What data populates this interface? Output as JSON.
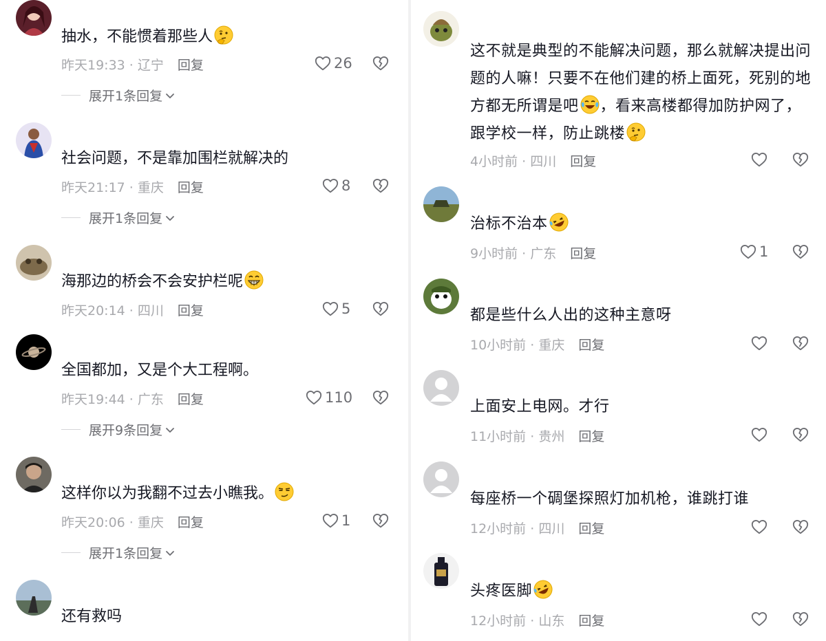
{
  "left_comments": [
    {
      "text": "抽水，不能惯着那些人",
      "emoji": "thinking-emoji",
      "time": "昨天19:33",
      "location": "辽宁",
      "reply_label": "回复",
      "likes": "26",
      "expand_label": "展开1条回复"
    },
    {
      "text": "社会问题，不是靠加围栏就解决的",
      "time": "昨天21:17",
      "location": "重庆",
      "reply_label": "回复",
      "likes": "8",
      "expand_label": "展开1条回复"
    },
    {
      "text": "海那边的桥会不会安护栏呢",
      "emoji": "grin-emoji",
      "time": "昨天20:14",
      "location": "四川",
      "reply_label": "回复",
      "likes": "5"
    },
    {
      "text": "全国都加，又是个大工程啊。",
      "time": "昨天19:44",
      "location": "广东",
      "reply_label": "回复",
      "likes": "110",
      "expand_label": "展开9条回复"
    },
    {
      "text": "这样你以为我翻不过去小瞧我。",
      "emoji": "smirk-emoji",
      "time": "昨天20:06",
      "location": "重庆",
      "reply_label": "回复",
      "likes": "1",
      "expand_label": "展开1条回复"
    },
    {
      "text": "还有救吗"
    }
  ],
  "right_comments": [
    {
      "text_parts": [
        "这不就是典型的不能解决问题，那么就解决提出问题的人嘛！只要不在他们建的桥上面死，死别的地方都无所谓是吧",
        "，看来高楼都得加防护网了，跟学校一样，防止跳楼"
      ],
      "emoji": "laugh-cry-emoji",
      "emoji2": "thinking-emoji",
      "time": "4小时前",
      "location": "四川",
      "reply_label": "回复",
      "likes": ""
    },
    {
      "text": "治标不治本",
      "emoji": "rofl-emoji",
      "time": "9小时前",
      "location": "广东",
      "reply_label": "回复",
      "likes": "1"
    },
    {
      "text": "都是些什么人出的这种主意呀",
      "time": "10小时前",
      "location": "重庆",
      "reply_label": "回复",
      "likes": ""
    },
    {
      "text": "上面安上电网。才行",
      "time": "11小时前",
      "location": "贵州",
      "reply_label": "回复",
      "likes": ""
    },
    {
      "text": "每座桥一个碉堡探照灯加机枪，谁跳打谁",
      "time": "12小时前",
      "location": "四川",
      "reply_label": "回复",
      "likes": ""
    },
    {
      "text": "头疼医脚",
      "emoji": "rofl-emoji",
      "time": "12小时前",
      "location": "山东",
      "reply_label": "回复",
      "likes": ""
    }
  ],
  "separator": " · ",
  "colors": {
    "text": "#161823",
    "meta": "#a8a9ad",
    "action": "#6d6e73",
    "background": "#ffffff"
  }
}
